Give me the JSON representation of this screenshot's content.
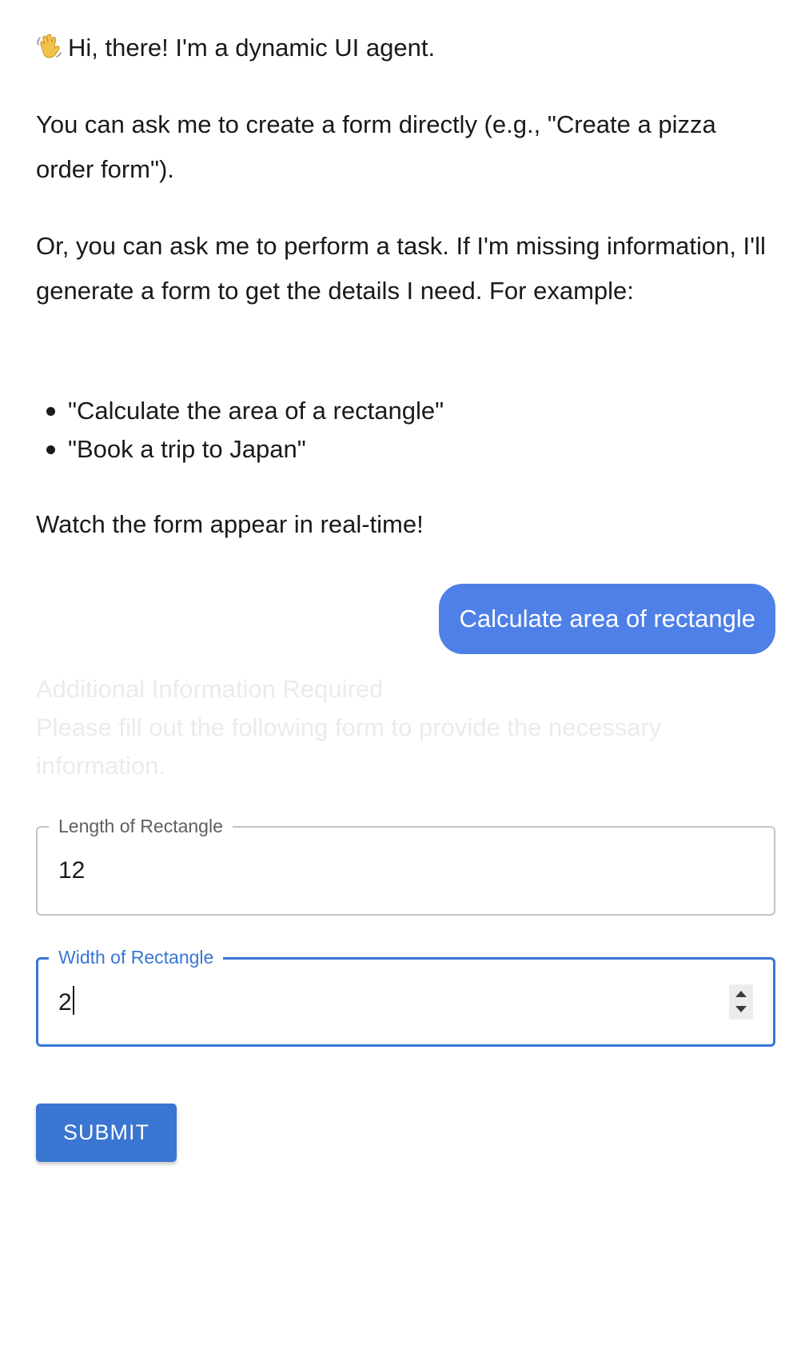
{
  "assistant": {
    "greeting": "Hi, there! I'm a dynamic UI agent.",
    "greeting_icon": "waving-hand-icon",
    "paragraph1": "You can ask me to create a form directly (e.g., \"Create a pizza order form\").",
    "paragraph2": "Or, you can ask me to perform a task. If I'm missing information, I'll generate a form to get the details I need. For example:",
    "examples": [
      "\"Calculate the area of a rectangle\"",
      "\"Book a trip to Japan\""
    ],
    "paragraph3": "Watch the form appear in real-time!"
  },
  "user_message": "Calculate area of rectangle",
  "form": {
    "title": "Additional Information Required",
    "description": "Please fill out the following form to provide the necessary information.",
    "fields": [
      {
        "label": "Length of Rectangle",
        "value": "12"
      },
      {
        "label": "Width of Rectangle",
        "value": "2"
      }
    ],
    "submit_label": "SUBMIT"
  },
  "colors": {
    "user_bubble": "#4f80e8",
    "focus_accent": "#3877d4",
    "submit_button": "#3a75d1",
    "faded_header_text": "#e9ebef"
  }
}
